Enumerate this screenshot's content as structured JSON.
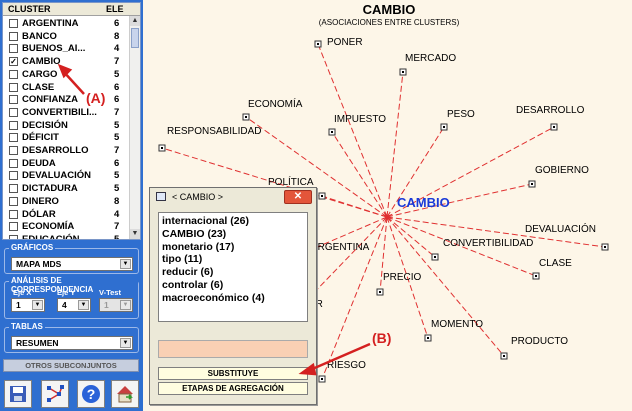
{
  "cluster_list": {
    "col_cluster": "CLUSTER",
    "col_ele": "ELE",
    "items": [
      {
        "name": "ARGENTINA",
        "count": "6",
        "checked": false
      },
      {
        "name": "BANCO",
        "count": "8",
        "checked": false
      },
      {
        "name": "BUENOS_AI...",
        "count": "4",
        "checked": false
      },
      {
        "name": "CAMBIO",
        "count": "7",
        "checked": true
      },
      {
        "name": "CARGO",
        "count": "5",
        "checked": false
      },
      {
        "name": "CLASE",
        "count": "6",
        "checked": false
      },
      {
        "name": "CONFIANZA",
        "count": "6",
        "checked": false
      },
      {
        "name": "CONVERTIBILI...",
        "count": "7",
        "checked": false
      },
      {
        "name": "DECISIÓN",
        "count": "5",
        "checked": false
      },
      {
        "name": "DÉFICIT",
        "count": "5",
        "checked": false
      },
      {
        "name": "DESARROLLO",
        "count": "7",
        "checked": false
      },
      {
        "name": "DEUDA",
        "count": "6",
        "checked": false
      },
      {
        "name": "DEVALUACIÓN",
        "count": "5",
        "checked": false
      },
      {
        "name": "DICTADURA",
        "count": "5",
        "checked": false
      },
      {
        "name": "DINERO",
        "count": "8",
        "checked": false
      },
      {
        "name": "DÓLAR",
        "count": "4",
        "checked": false
      },
      {
        "name": "ECONOMÍA",
        "count": "7",
        "checked": false
      },
      {
        "name": "EDUCACIÓN",
        "count": "5",
        "checked": false
      }
    ]
  },
  "graficos": {
    "title": "GRÁFICOS",
    "value": "MAPA  MDS"
  },
  "analisis": {
    "title": "ANÁLISIS DE CORRESPONDENCIA",
    "eje_x_label": "Eje X",
    "eje_y_label": "Eje Y",
    "vtest_label": "V-Test",
    "eje_x": "1",
    "eje_y": "4",
    "vtest": "1"
  },
  "tablas": {
    "title": "TABLAS",
    "value": "RESUMEN"
  },
  "otros_label": "OTROS SUBCONJUNTOS",
  "toolbar_icons": [
    "save-icon",
    "network-icon",
    "help-icon",
    "home-icon"
  ],
  "graph": {
    "title": "CAMBIO",
    "subtitle": "(ASOCIACIONES ENTRE CLUSTERS)",
    "center": "CAMBIO",
    "nodes": [
      "PONER",
      "MERCADO",
      "ECONOMÍA",
      "IMPUESTO",
      "PESO",
      "DESARROLLO",
      "RESPONSABILIDAD",
      "GOBIERNO",
      "POLÍTICA",
      "DEVALUACIÓN",
      "ARGENTINA",
      "CONVERTIBILIDAD",
      "CLASE",
      "PRECIO",
      "AR",
      "MOMENTO",
      "PRODUCTO",
      "RIESGO"
    ],
    "line_color": "#e03030",
    "center_color": "#1a3ad8"
  },
  "dialog": {
    "title": "< CAMBIO >",
    "close_label": "✕",
    "items": [
      "internacional (26)",
      "CAMBIO (23)",
      "monetario (17)",
      "tipo (11)",
      "reducir (6)",
      "controlar (6)",
      "macroeconómico (4)"
    ],
    "substituye_label": "SUBSTITUYE",
    "etapas_label": "ETAPAS DE AGREGACIÓN"
  },
  "annotations": {
    "a": "(A)",
    "b": "(B)"
  }
}
